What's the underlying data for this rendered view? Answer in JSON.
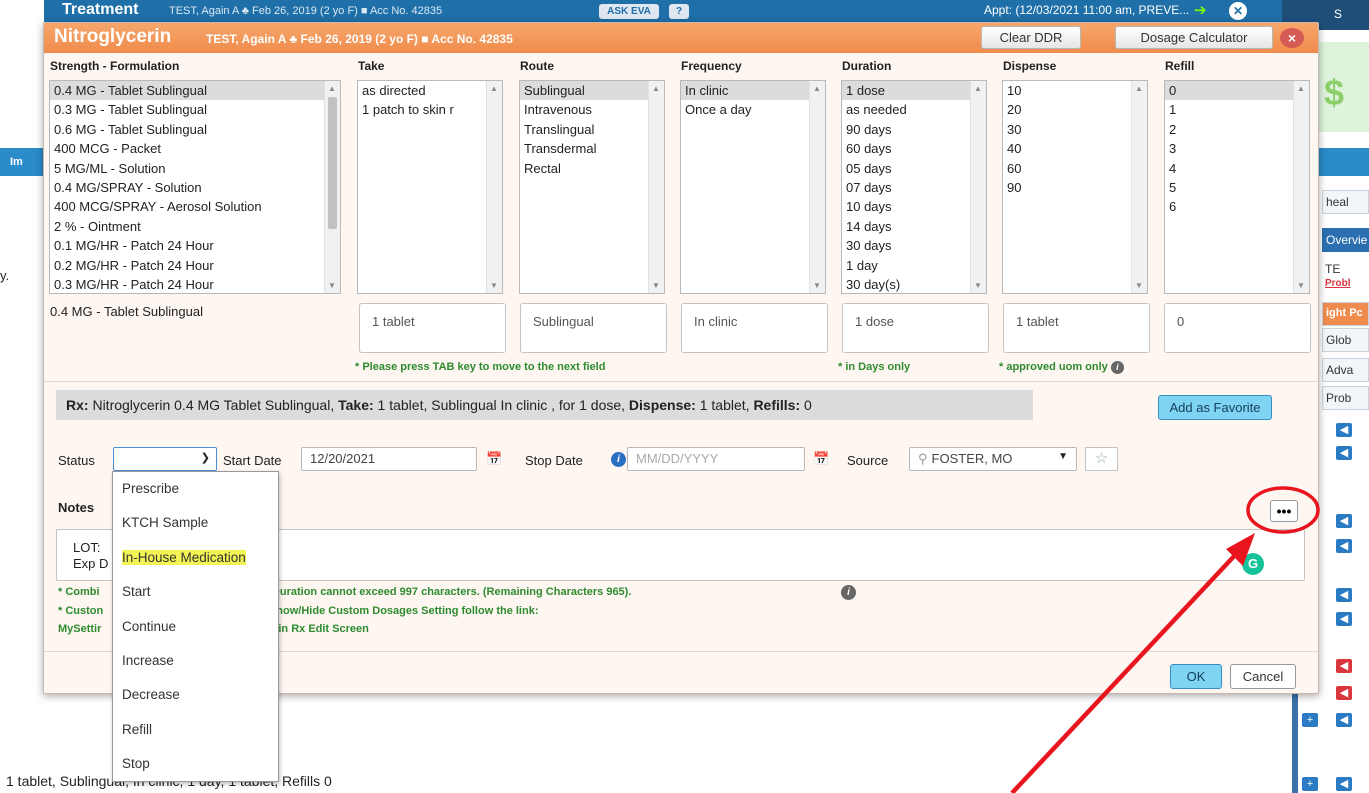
{
  "background": {
    "title": "Treatment",
    "patient": "TEST, Again A  ♣ Feb 26, 2019 (2 yo F)  ■ Acc No. 42835",
    "askeva": "ASK EVA",
    "help": "?",
    "appointment": "Appt: (12/03/2021 11:00 am, PREVE...",
    "right_top": "S",
    "dollar": "$",
    "left_tab": "Im",
    "left_text": "y.",
    "bottom_text": "1 tablet, Sublingual, In clinic, 1 day, 1 tablet, Refills 0",
    "side_labels": [
      "heal",
      "Overvie",
      "TE",
      "Probl",
      "ight Pc",
      "Glob",
      "Adva",
      "Prob"
    ]
  },
  "modal": {
    "title": "Nitroglycerin",
    "patient": "TEST, Again A  ♣ Feb 26, 2019 (2 yo F)  ■ Acc No. 42835",
    "clear_ddr": "Clear DDR",
    "dosage_calculator": "Dosage Calculator",
    "close": "×"
  },
  "columns": {
    "strength": "Strength - Formulation",
    "take": "Take",
    "route": "Route",
    "frequency": "Frequency",
    "duration": "Duration",
    "dispense": "Dispense",
    "refill": "Refill"
  },
  "lists": {
    "strength": [
      "0.4 MG - Tablet Sublingual",
      "0.3 MG - Tablet Sublingual",
      "0.6 MG - Tablet Sublingual",
      "400 MCG - Packet",
      "5 MG/ML - Solution",
      "0.4 MG/SPRAY - Solution",
      "400 MCG/SPRAY - Aerosol Solution",
      "2 % - Ointment",
      "0.1 MG/HR - Patch 24 Hour",
      "0.2 MG/HR - Patch 24 Hour",
      "0.3 MG/HR - Patch 24 Hour"
    ],
    "take": [
      "as directed",
      "1 patch to skin r"
    ],
    "route": [
      "Sublingual",
      "Intravenous",
      "Translingual",
      "Transdermal",
      "Rectal"
    ],
    "frequency": [
      "In clinic",
      "Once a day"
    ],
    "duration": [
      "1 dose",
      "as needed",
      "90 days",
      "60 days",
      "05 days",
      "07 days",
      "10 days",
      "14 days",
      "30 days",
      "1 day",
      "30 day(s)"
    ],
    "dispense": [
      "10",
      "20",
      "30",
      "40",
      "60",
      "90"
    ],
    "refill": [
      "0",
      "1",
      "2",
      "3",
      "4",
      "5",
      "6"
    ]
  },
  "selected": {
    "strength": "0.4 MG - Tablet Sublingual",
    "take": "1 tablet",
    "route": "Sublingual",
    "frequency": "In clinic",
    "duration": "1 dose",
    "dispense": "1 tablet",
    "refill": "0"
  },
  "hints": {
    "tab": "* Please press TAB key to move to the next field",
    "days": "* in Days only",
    "uom": "* approved uom only"
  },
  "rx_summary": {
    "rx_label": "Rx:",
    "rx_text": " Nitroglycerin 0.4 MG Tablet Sublingual, ",
    "take_label": "Take:",
    "take_text": " 1 tablet, Sublingual In clinic , for 1 dose, ",
    "dispense_label": "Dispense:",
    "dispense_text": " 1 tablet, ",
    "refills_label": "Refills:",
    "refills_text": " 0"
  },
  "add_favorite": "Add as Favorite",
  "form": {
    "status_label": "Status",
    "status_value": "",
    "start_date_label": "Start Date",
    "start_date_value": "12/20/2021",
    "stop_date_label": "Stop Date",
    "stop_date_placeholder": "MM/DD/YYYY",
    "source_label": "Source",
    "source_value": "FOSTER, MO"
  },
  "notes": {
    "label": "Notes",
    "more": "•••",
    "line1": "LOT:",
    "line2": "Exp D",
    "note1_a": "* Combi",
    "note1_b": ",Frequency and Duration cannot exceed 997 characters. (Remaining Characters 965).",
    "note2_a": "* Custon",
    "note2_b": "by default. To Show/Hide Custom Dosages Setting follow the link:",
    "note3_a": "MySettir",
    "note3_b": "ustom Dosages in Rx Edit Screen"
  },
  "buttons": {
    "ok": "OK",
    "cancel": "Cancel"
  },
  "status_dropdown": {
    "options": [
      "Prescribe",
      "KTCH Sample",
      "In-House Medication",
      "Start",
      "Continue",
      "Increase",
      "Decrease",
      "Refill",
      "Stop"
    ],
    "highlighted": "In-House Medication"
  },
  "colors": {
    "header_orange": "#ef8c4d",
    "topbar_blue": "#1f6fa8",
    "hint_green": "#2e8b2e",
    "annotation_red": "#e8141e",
    "highlight_yellow": "#f4f454"
  }
}
